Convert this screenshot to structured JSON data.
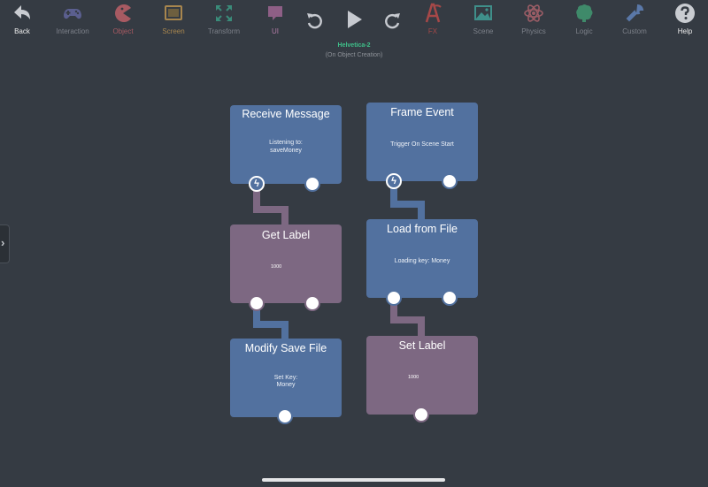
{
  "toolbar": {
    "items": [
      {
        "label": "Back",
        "icon": "back-arrow-icon"
      },
      {
        "label": "Interaction",
        "icon": "gamepad-icon"
      },
      {
        "label": "Object",
        "icon": "pacman-icon"
      },
      {
        "label": "Screen",
        "icon": "screen-frame-icon"
      },
      {
        "label": "Transform",
        "icon": "expand-arrows-icon"
      },
      {
        "label": "UI",
        "icon": "speech-bubble-icon"
      },
      {
        "label": "",
        "icon": "undo-icon"
      },
      {
        "label": "",
        "icon": "play-icon"
      },
      {
        "label": "",
        "icon": "redo-icon"
      },
      {
        "label": "FX",
        "icon": "fx-icon"
      },
      {
        "label": "Scene",
        "icon": "image-icon"
      },
      {
        "label": "Physics",
        "icon": "atom-icon"
      },
      {
        "label": "Logic",
        "icon": "brain-icon"
      },
      {
        "label": "Custom",
        "icon": "wrench-icon"
      },
      {
        "label": "Help",
        "icon": "help-icon"
      }
    ]
  },
  "header": {
    "title": "Helvetica-2",
    "subtitle": "(On Object Creation)"
  },
  "nodes": {
    "receive_message": {
      "title": "Receive Message",
      "line1": "Listening to:",
      "line2": "saveMoney"
    },
    "get_label": {
      "title": "Get Label",
      "value": "1000"
    },
    "modify_save_file": {
      "title": "Modify Save File",
      "line1": "Set Key:",
      "line2": "Money"
    },
    "frame_event": {
      "title": "Frame Event",
      "line1": "Trigger On Scene Start"
    },
    "load_from_file": {
      "title": "Load from File",
      "line1": "Loading key: Money"
    },
    "set_label": {
      "title": "Set Label",
      "value": "1000"
    }
  },
  "colors": {
    "background": "#353b43",
    "node_blue": "#52719f",
    "node_mauve": "#7d6882",
    "title_green": "#3fc08a"
  }
}
